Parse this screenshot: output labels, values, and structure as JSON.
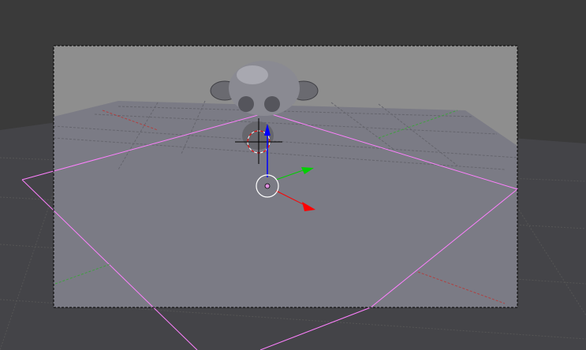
{
  "viewport": {
    "type": "3d-viewport-camera-view",
    "colors": {
      "background": "#3a3a3a",
      "floor_outside": "#444444",
      "wall": "#8e8e8e",
      "floor_inside": "#7b7b85",
      "plane_edge": "#ff80ff",
      "x_axis": "#ff0000",
      "y_axis": "#00d000",
      "z_axis": "#0000ff"
    },
    "icons": [
      "camera-frame",
      "monkey-mesh",
      "3d-cursor-icon",
      "transform-gizmo-icon",
      "object-origin-icon"
    ]
  }
}
